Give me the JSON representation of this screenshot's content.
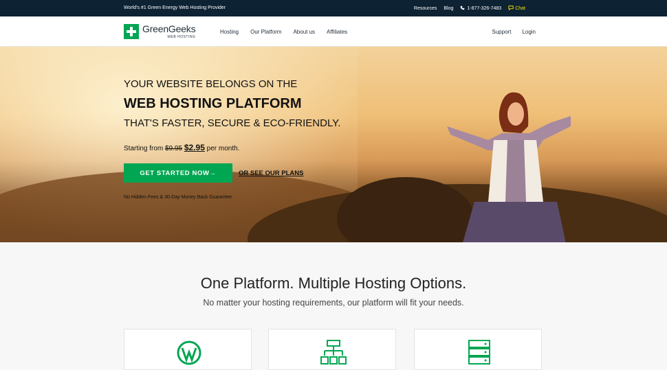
{
  "topbar": {
    "tagline": "World's #1 Green Energy Web Hosting Provider",
    "resources": "Resources",
    "blog": "Blog",
    "phone": "1-877-326-7483",
    "chat": "Chat"
  },
  "nav": {
    "logo_name": "GreenGeeks",
    "logo_sub": "WEB HOSTING",
    "items": [
      "Hosting",
      "Our Platform",
      "About us",
      "Affiliates"
    ],
    "support": "Support",
    "login": "Login"
  },
  "hero": {
    "line1": "YOUR WEBSITE BELONGS ON THE",
    "line2": "WEB HOSTING PLATFORM",
    "line3": "THAT'S FASTER, SECURE & ECO-FRIENDLY.",
    "price_prefix": "Starting from",
    "old_price": "$9.95",
    "new_price": "$2.95",
    "price_suffix": "per month.",
    "cta": "GET STARTED NOW",
    "cta_arrow": "→",
    "plans_link": "OR SEE OUR PLANS",
    "guarantee": "No Hidden Fees & 30-Day Money Back Guarantee"
  },
  "section": {
    "title": "One Platform. Multiple Hosting Options.",
    "subtitle": "No matter your hosting requirements, our platform will fit your needs."
  },
  "cards": [
    {
      "icon": "wordpress-icon"
    },
    {
      "icon": "network-icon"
    },
    {
      "icon": "server-icon"
    }
  ],
  "colors": {
    "brand_green": "#00a651",
    "topbar_bg": "#0d2233",
    "chat_yellow": "#f4e400"
  }
}
